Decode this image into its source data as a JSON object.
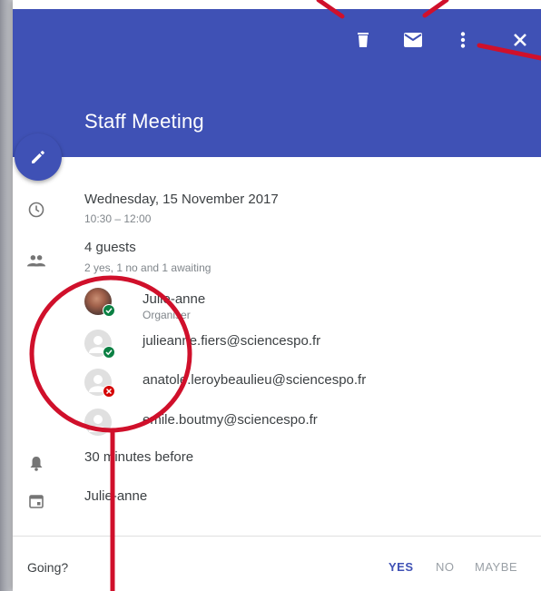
{
  "event": {
    "title": "Staff Meeting",
    "date": "Wednesday, 15 November 2017",
    "time": "10:30 – 12:00",
    "guests_count": "4 guests",
    "guests_summary": "2 yes, 1 no and 1 awaiting",
    "reminder": "30 minutes before",
    "calendar": "Julie-anne"
  },
  "guests": [
    {
      "name": "Julie-anne",
      "role": "Organiser",
      "status": "yes"
    },
    {
      "name": "julieanne.fiers@sciencespo.fr",
      "status": "yes"
    },
    {
      "name": "anatole.leroybeaulieu@sciencespo.fr",
      "status": "no"
    },
    {
      "name": "emile.boutmy@sciencespo.fr",
      "status": "awaiting"
    }
  ],
  "rsvp": {
    "label": "Going?",
    "yes": "YES",
    "no": "NO",
    "maybe": "MAYBE"
  },
  "toolbar": {
    "icons": [
      "delete-icon",
      "email-icon",
      "more-vert-icon",
      "close-icon"
    ]
  },
  "colors": {
    "header": "#3f51b5",
    "accent": "#3f51b5",
    "yes_badge": "#0b8043",
    "no_badge": "#d50000",
    "annotation": "#d0102b"
  }
}
